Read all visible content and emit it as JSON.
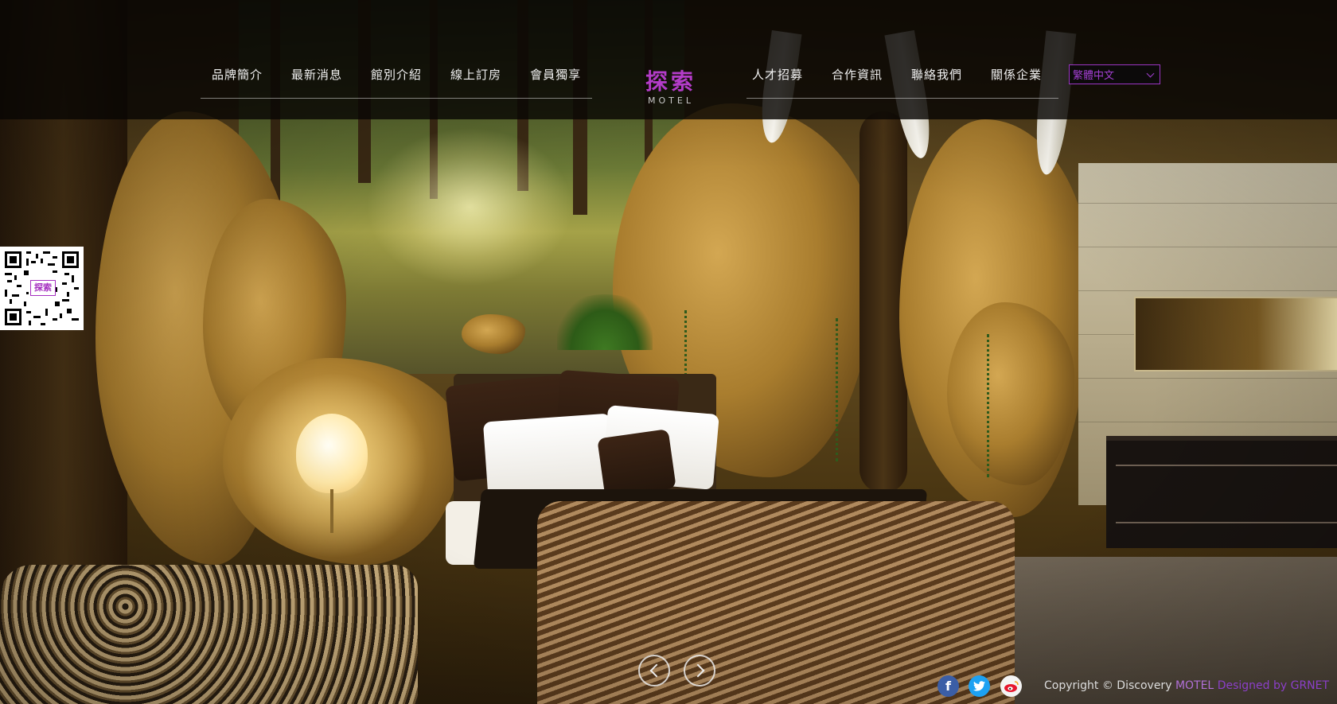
{
  "header": {
    "nav_left": [
      "品牌簡介",
      "最新消息",
      "館別介紹",
      "線上訂房",
      "會員獨享"
    ],
    "nav_right": [
      "人才招募",
      "合作資訊",
      "聯絡我們",
      "關係企業"
    ],
    "logo_cn": "探索",
    "logo_en": "MOTEL",
    "language_selected": "繁體中文"
  },
  "qr": {
    "label": "探索"
  },
  "slider": {
    "prev_icon": "chevron-left-icon",
    "next_icon": "chevron-right-icon"
  },
  "footer": {
    "social_icons": [
      "facebook-icon",
      "twitter-icon",
      "weibo-icon"
    ],
    "copyright_prefix": "Copyright © Discovery ",
    "copyright_motel": "MOTEL",
    "designed_by": "Designed by GRNET"
  },
  "colors": {
    "accent": "#a23fd1",
    "header_bg": "#080604",
    "facebook": "#3b5ea6",
    "twitter": "#1da1f2"
  }
}
